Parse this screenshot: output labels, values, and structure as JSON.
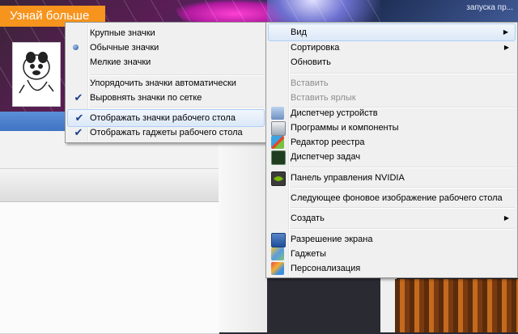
{
  "banner": {
    "label": "Узнай больше"
  },
  "tray": {
    "text": "запуска пр..."
  },
  "main_menu": {
    "items": [
      {
        "label": "Вид",
        "submenu": true,
        "state": "highlighted"
      },
      {
        "label": "Сортировка",
        "submenu": true
      },
      {
        "label": "Обновить"
      },
      {
        "label": "Вставить",
        "disabled": true
      },
      {
        "label": "Вставить ярлык",
        "disabled": true
      },
      {
        "label": "Диспетчер устройств",
        "icon": "device-manager-icon"
      },
      {
        "label": "Программы и компоненты",
        "icon": "programs-icon"
      },
      {
        "label": "Редактор реестра",
        "icon": "registry-editor-icon"
      },
      {
        "label": "Диспетчер задач",
        "icon": "task-manager-icon"
      },
      {
        "label": "Панель управления NVIDIA",
        "icon": "nvidia-icon"
      },
      {
        "label": "Следующее фоновое изображение рабочего стола"
      },
      {
        "label": "Создать",
        "submenu": true
      },
      {
        "label": "Разрешение экрана",
        "icon": "screen-resolution-icon"
      },
      {
        "label": "Гаджеты",
        "icon": "gadgets-icon"
      },
      {
        "label": "Персонализация",
        "icon": "personalization-icon"
      }
    ]
  },
  "view_menu": {
    "items": [
      {
        "label": "Крупные значки"
      },
      {
        "label": "Обычные значки",
        "selected": true
      },
      {
        "label": "Мелкие значки"
      },
      {
        "label": "Упорядочить значки автоматически"
      },
      {
        "label": "Выровнять значки по сетке",
        "checked": true
      },
      {
        "label": "Отображать значки рабочего стола",
        "checked": true,
        "state": "highlighted"
      },
      {
        "label": "Отображать гаджеты  рабочего стола",
        "checked": true
      }
    ]
  },
  "glyphs": {
    "check": "✔",
    "arrow": "▶"
  },
  "colors": {
    "banner": "#f7941d",
    "menu_bg": "#f0f0f0",
    "highlight_border": "#aecff7"
  }
}
